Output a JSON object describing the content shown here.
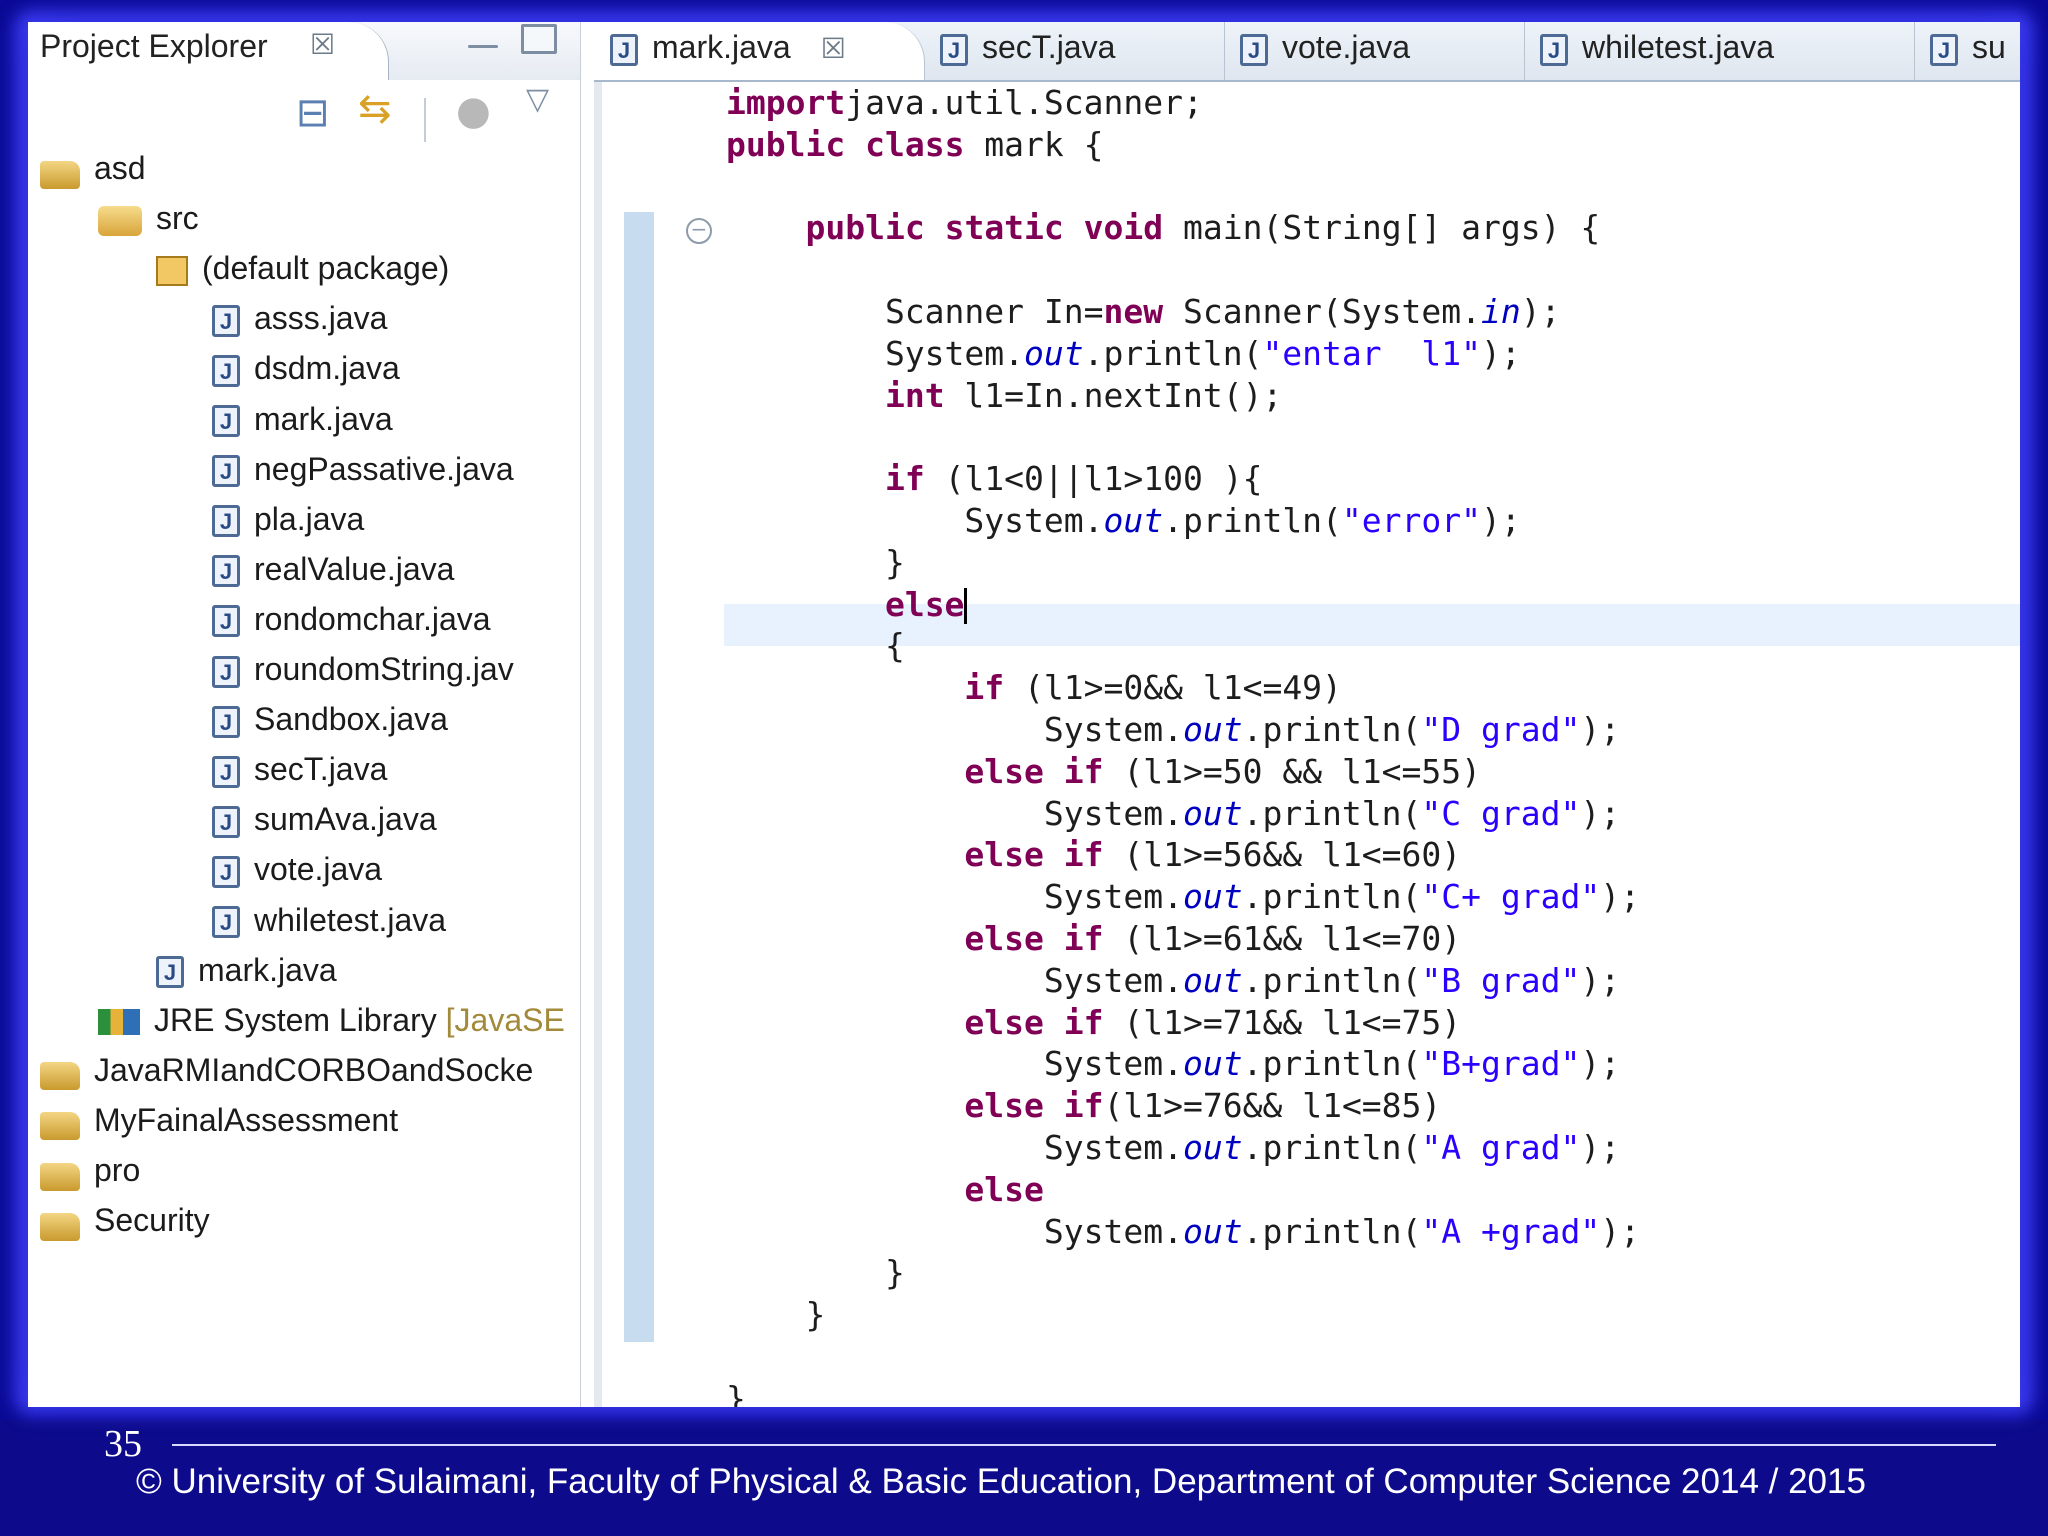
{
  "explorer": {
    "title": "Project Explorer",
    "close_glyph": "☒",
    "tree": [
      {
        "label": "asd",
        "icon": "project-icon",
        "depth": 0
      },
      {
        "label": "src",
        "icon": "source-folder-icon",
        "depth": 1
      },
      {
        "label": "(default package)",
        "icon": "package-icon",
        "depth": 2
      },
      {
        "label": "asss.java",
        "icon": "java-file-warning-icon",
        "depth": 3
      },
      {
        "label": "dsdm.java",
        "icon": "java-file-icon",
        "depth": 3
      },
      {
        "label": "mark.java",
        "icon": "java-file-icon",
        "depth": 3
      },
      {
        "label": "negPassative.java",
        "icon": "java-file-icon",
        "depth": 3
      },
      {
        "label": "pla.java",
        "icon": "java-file-icon",
        "depth": 3
      },
      {
        "label": "realValue.java",
        "icon": "java-file-icon",
        "depth": 3
      },
      {
        "label": "rondomchar.java",
        "icon": "java-file-icon",
        "depth": 3
      },
      {
        "label": "roundomString.jav",
        "icon": "java-file-icon",
        "depth": 3
      },
      {
        "label": "Sandbox.java",
        "icon": "java-file-icon",
        "depth": 3
      },
      {
        "label": "secT.java",
        "icon": "java-file-icon",
        "depth": 3
      },
      {
        "label": "sumAva.java",
        "icon": "java-file-icon",
        "depth": 3
      },
      {
        "label": "vote.java",
        "icon": "java-file-icon",
        "depth": 3
      },
      {
        "label": "whiletest.java",
        "icon": "java-file-icon",
        "depth": 3
      },
      {
        "label": "mark.java",
        "icon": "java-file-icon",
        "depth": 2
      },
      {
        "label": "JRE System Library",
        "suffix": "[JavaSE",
        "icon": "library-icon",
        "depth": 1
      },
      {
        "label": "JavaRMIandCORBOandSocke",
        "icon": "project-icon",
        "depth": 0
      },
      {
        "label": "MyFainalAssessment",
        "icon": "project-icon",
        "depth": 0
      },
      {
        "label": "pro",
        "icon": "project-icon",
        "depth": 0
      },
      {
        "label": "Security",
        "icon": "project-icon",
        "depth": 0
      }
    ]
  },
  "editor": {
    "tabs": [
      {
        "label": "mark.java",
        "active": true,
        "closable": true
      },
      {
        "label": "secT.java",
        "active": false
      },
      {
        "label": "vote.java",
        "active": false
      },
      {
        "label": "whiletest.java",
        "active": false
      },
      {
        "label": "su",
        "active": false
      }
    ],
    "code_lines": [
      [
        [
          "kw",
          "import"
        ],
        [
          "",
          "java.util.Scanner;"
        ]
      ],
      [
        [
          "kw",
          "public"
        ],
        [
          "",
          " "
        ],
        [
          "kw",
          "class"
        ],
        [
          "",
          " mark {"
        ]
      ],
      [],
      [
        [
          "",
          "    "
        ],
        [
          "kw",
          "public"
        ],
        [
          "",
          " "
        ],
        [
          "kw",
          "static"
        ],
        [
          "",
          " "
        ],
        [
          "kw",
          "void"
        ],
        [
          "",
          " main(String[] args) {"
        ]
      ],
      [],
      [
        [
          "",
          "        Scanner In="
        ],
        [
          "kw",
          "new"
        ],
        [
          "",
          " Scanner(System."
        ],
        [
          "fld",
          "in"
        ],
        [
          "",
          ");"
        ]
      ],
      [
        [
          "",
          "        System."
        ],
        [
          "fld",
          "out"
        ],
        [
          "",
          ".println("
        ],
        [
          "str",
          "\"entar  l1\""
        ],
        [
          "",
          ");"
        ]
      ],
      [
        [
          "",
          "        "
        ],
        [
          "kw",
          "int"
        ],
        [
          "",
          " l1=In.nextInt();"
        ]
      ],
      [],
      [
        [
          "",
          "        "
        ],
        [
          "kw",
          "if"
        ],
        [
          "",
          " (l1<0||l1>100 ){"
        ]
      ],
      [
        [
          "",
          "            System."
        ],
        [
          "fld",
          "out"
        ],
        [
          "",
          ".println("
        ],
        [
          "str",
          "\"error\""
        ],
        [
          "",
          ");"
        ]
      ],
      [
        [
          "",
          "        }"
        ]
      ],
      [
        [
          "",
          "        "
        ],
        [
          "kw",
          "else"
        ],
        [
          "caret",
          ""
        ]
      ],
      [
        [
          "",
          "        {"
        ]
      ],
      [
        [
          "",
          "            "
        ],
        [
          "kw",
          "if"
        ],
        [
          "",
          " (l1>=0&& l1<=49)"
        ]
      ],
      [
        [
          "",
          "                System."
        ],
        [
          "fld",
          "out"
        ],
        [
          "",
          ".println("
        ],
        [
          "str",
          "\"D grad\""
        ],
        [
          "",
          ");"
        ]
      ],
      [
        [
          "",
          "            "
        ],
        [
          "kw",
          "else"
        ],
        [
          "",
          " "
        ],
        [
          "kw",
          "if"
        ],
        [
          "",
          " (l1>=50 && l1<=55)"
        ]
      ],
      [
        [
          "",
          "                System."
        ],
        [
          "fld",
          "out"
        ],
        [
          "",
          ".println("
        ],
        [
          "str",
          "\"C grad\""
        ],
        [
          "",
          ");"
        ]
      ],
      [
        [
          "",
          "            "
        ],
        [
          "kw",
          "else"
        ],
        [
          "",
          " "
        ],
        [
          "kw",
          "if"
        ],
        [
          "",
          " (l1>=56&& l1<=60)"
        ]
      ],
      [
        [
          "",
          "                System."
        ],
        [
          "fld",
          "out"
        ],
        [
          "",
          ".println("
        ],
        [
          "str",
          "\"C+ grad\""
        ],
        [
          "",
          ");"
        ]
      ],
      [
        [
          "",
          "            "
        ],
        [
          "kw",
          "else"
        ],
        [
          "",
          " "
        ],
        [
          "kw",
          "if"
        ],
        [
          "",
          " (l1>=61&& l1<=70)"
        ]
      ],
      [
        [
          "",
          "                System."
        ],
        [
          "fld",
          "out"
        ],
        [
          "",
          ".println("
        ],
        [
          "str",
          "\"B grad\""
        ],
        [
          "",
          ");"
        ]
      ],
      [
        [
          "",
          "            "
        ],
        [
          "kw",
          "else"
        ],
        [
          "",
          " "
        ],
        [
          "kw",
          "if"
        ],
        [
          "",
          " (l1>=71&& l1<=75)"
        ]
      ],
      [
        [
          "",
          "                System."
        ],
        [
          "fld",
          "out"
        ],
        [
          "",
          ".println("
        ],
        [
          "str",
          "\"B+grad\""
        ],
        [
          "",
          ");"
        ]
      ],
      [
        [
          "",
          "            "
        ],
        [
          "kw",
          "else"
        ],
        [
          "",
          " "
        ],
        [
          "kw",
          "if"
        ],
        [
          "",
          "(l1>=76&& l1<=85)"
        ]
      ],
      [
        [
          "",
          "                System."
        ],
        [
          "fld",
          "out"
        ],
        [
          "",
          ".println("
        ],
        [
          "str",
          "\"A grad\""
        ],
        [
          "",
          ");"
        ]
      ],
      [
        [
          "",
          "            "
        ],
        [
          "kw",
          "else"
        ]
      ],
      [
        [
          "",
          "                System."
        ],
        [
          "fld",
          "out"
        ],
        [
          "",
          ".println("
        ],
        [
          "str",
          "\"A +grad\""
        ],
        [
          "",
          ");"
        ]
      ],
      [
        [
          "",
          "        }"
        ]
      ],
      [
        [
          "",
          "    }"
        ]
      ],
      [],
      [
        [
          "",
          "}"
        ]
      ]
    ]
  },
  "footer": {
    "slide_number": "35",
    "text": "© University of Sulaimani, Faculty of Physical & Basic Education, Department of Computer Science  2014 / 2015"
  },
  "colors": {
    "keyword": "#7f0055",
    "string": "#2a00ff",
    "field": "#0000c0",
    "background": "#0d0b8c"
  }
}
